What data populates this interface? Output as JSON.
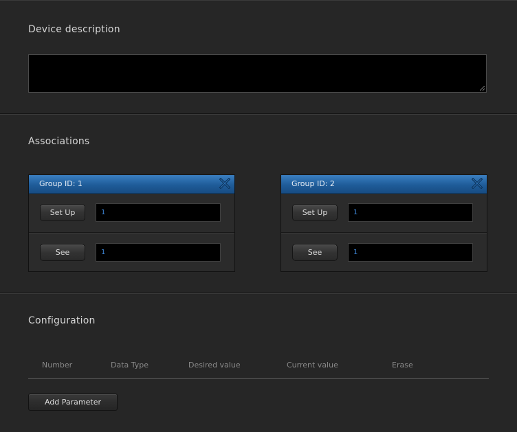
{
  "device_description": {
    "title": "Device description",
    "value": ""
  },
  "associations": {
    "title": "Associations",
    "groups": [
      {
        "title": "Group ID: 1",
        "setup_label": "Set Up",
        "setup_value": "1",
        "see_label": "See",
        "see_value": "1",
        "close_icon": "close-x-icon"
      },
      {
        "title": "Group ID: 2",
        "setup_label": "Set Up",
        "setup_value": "1",
        "see_label": "See",
        "see_value": "1",
        "close_icon": "close-x-icon"
      }
    ]
  },
  "configuration": {
    "title": "Configuration",
    "columns": [
      "Number",
      "Data Type",
      "Desired value",
      "Current value",
      "Erase"
    ],
    "add_button_label": "Add Parameter"
  },
  "colors": {
    "background": "#262626",
    "header_blue": "#1f5c99",
    "value_blue": "#3d86d6"
  }
}
